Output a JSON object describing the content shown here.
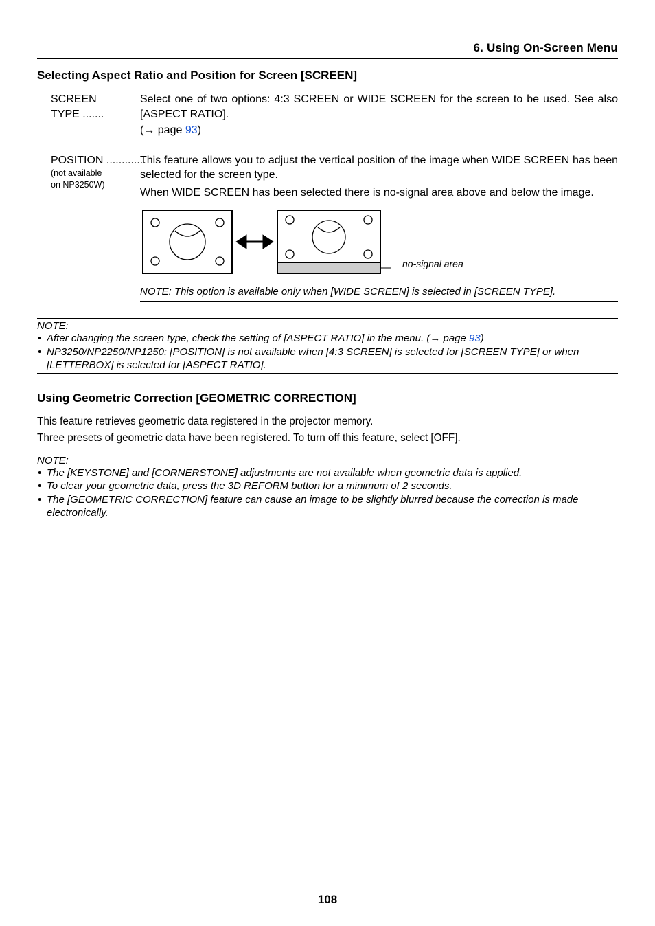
{
  "header": {
    "chapter": "6. Using On-Screen Menu"
  },
  "sections": {
    "screen": {
      "heading": "Selecting Aspect Ratio and Position for Screen [SCREEN]",
      "screen_type": {
        "term": "SCREEN TYPE",
        "dots": ".......",
        "desc": "Select one of two options: 4:3 SCREEN or WIDE SCREEN for the screen to be used. See also [ASPECT RATIO].",
        "ref_prefix": "(→ page ",
        "ref_page": "93",
        "ref_suffix": ")"
      },
      "position": {
        "term": "POSITION",
        "dots": ".............",
        "sub1": "(not available",
        "sub2": "on NP3250W)",
        "desc1": "This feature allows you to adjust the vertical position of the image when WIDE SCREEN has been selected for the screen type.",
        "desc2": "When WIDE SCREEN has been selected there is no-signal area above and below the image.",
        "nosignal_label": "no-signal area",
        "inline_note": "NOTE: This option is available only when [WIDE SCREEN] is selected in [SCREEN TYPE]."
      },
      "note_block": {
        "label": "NOTE:",
        "items": [
          {
            "pre": "After changing the screen type, check the setting of [ASPECT RATIO] in the menu. (→ page ",
            "link": "93",
            "post": ")"
          },
          {
            "pre": "NP3250/NP2250/NP1250: [POSITION] is not available when [4:3 SCREEN] is selected for [SCREEN TYPE] or when [LETTERBOX] is selected for [ASPECT RATIO].",
            "link": "",
            "post": ""
          }
        ]
      }
    },
    "geo": {
      "heading": "Using Geometric Correction [GEOMETRIC CORRECTION]",
      "body1": "This feature retrieves geometric data registered in the projector memory.",
      "body2": "Three presets of geometric data have been registered. To turn off this feature, select [OFF].",
      "note_block": {
        "label": "NOTE:",
        "items": [
          "The [KEYSTONE] and [CORNERSTONE] adjustments are not available when geometric data is applied.",
          "To clear your geometric data, press the 3D REFORM button for a minimum of 2 seconds.",
          "The [GEOMETRIC CORRECTION] feature can cause an image to be slightly blurred because the correction is made electronically."
        ]
      }
    }
  },
  "page_number": "108"
}
